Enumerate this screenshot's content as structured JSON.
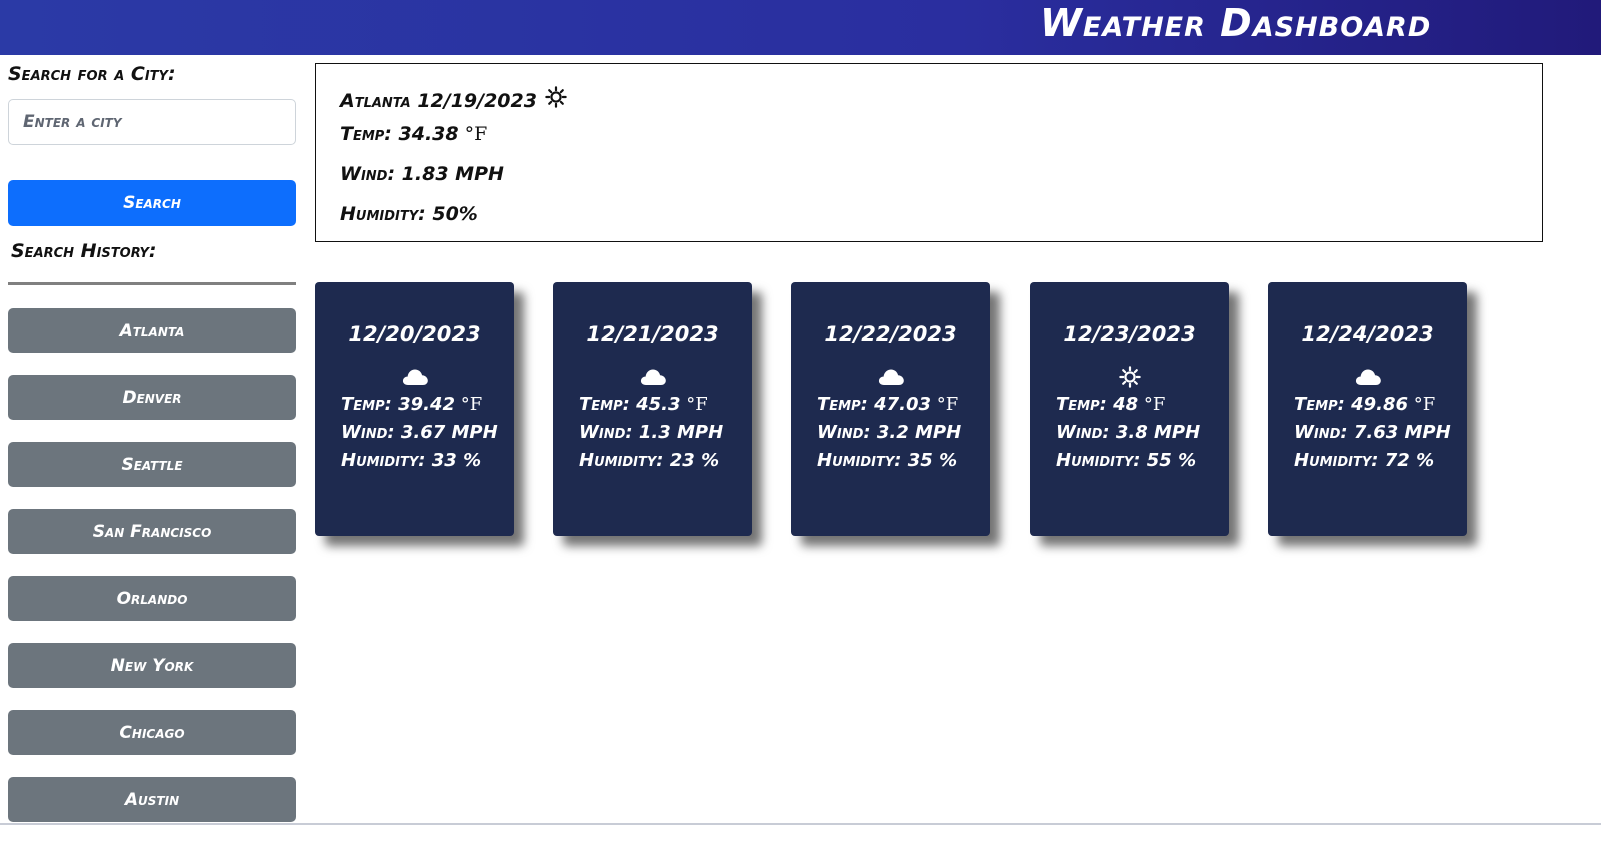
{
  "header": {
    "title": "Weather Dashboard"
  },
  "sidebar": {
    "search_label": "Search for a City:",
    "input_placeholder": "Enter a city",
    "search_button": "Search",
    "history_label": "Search History:",
    "history": [
      "Atlanta",
      "Denver",
      "Seattle",
      "San Francisco",
      "Orlando",
      "New York",
      "Chicago",
      "Austin"
    ]
  },
  "current": {
    "title": "Atlanta 12/19/2023",
    "icon": "sun-icon",
    "temp_label": "Temp: 34.38",
    "temp_unit": "°F",
    "wind": "Wind: 1.83 MPH",
    "humidity": "Humidity: 50%"
  },
  "forecast": [
    {
      "date": "12/20/2023",
      "icon": "cloud-icon",
      "temp": "Temp: 39.42",
      "unit": "°F",
      "wind": "Wind: 3.67 MPH",
      "humidity": "Humidity: 33 %"
    },
    {
      "date": "12/21/2023",
      "icon": "cloud-icon",
      "temp": "Temp: 45.3",
      "unit": "°F",
      "wind": "Wind: 1.3 MPH",
      "humidity": "Humidity: 23 %"
    },
    {
      "date": "12/22/2023",
      "icon": "cloud-icon",
      "temp": "Temp: 47.03",
      "unit": "°F",
      "wind": "Wind: 3.2 MPH",
      "humidity": "Humidity: 35 %"
    },
    {
      "date": "12/23/2023",
      "icon": "sun-icon",
      "temp": "Temp: 48",
      "unit": "°F",
      "wind": "Wind: 3.8 MPH",
      "humidity": "Humidity: 55 %"
    },
    {
      "date": "12/24/2023",
      "icon": "cloud-icon",
      "temp": "Temp: 49.86",
      "unit": "°F",
      "wind": "Wind: 7.63 MPH",
      "humidity": "Humidity: 72 %"
    }
  ],
  "colors": {
    "header_start": "#2b3aa6",
    "header_end": "#211a7a",
    "search_button": "#0d6efd",
    "history_button": "#6c757d",
    "card_bg": "#1e2a4f"
  }
}
